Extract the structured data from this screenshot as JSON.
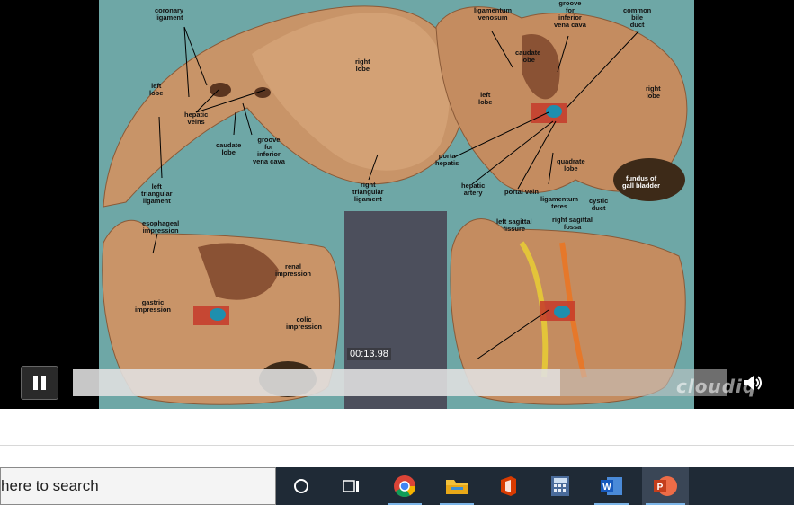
{
  "slide_labels": {
    "coronary_ligament": "coronary\nligament",
    "right_lobe_1": "right\nlobe",
    "left_lobe_1": "left\nlobe",
    "hepatic_veins": "hepatic\nveins",
    "caudate_lobe_1": "caudate\nlobe",
    "groove_ivc_1": "groove\nfor\ninferior\nvena cava",
    "left_triangular_ligament": "left\ntriangular\nligament",
    "right_triangular_ligament": "right\ntriangular\nligament",
    "ligamentum_venosum": "ligamentum\nvenosum",
    "groove_ivc_2": "groove\nfor\ninferior\nvena cava",
    "common_bile_duct": "common\nbile\nduct",
    "caudate_lobe_2": "caudate\nlobe",
    "left_lobe_2": "left\nlobe",
    "right_lobe_2": "right\nlobe",
    "porta_hepatis": "porta\nhepatis",
    "quadrate_lobe": "quadrate\nlobe",
    "hepatic_artery": "hepatic\nartery",
    "portal_vein": "portal vein",
    "ligamentum_teres": "ligamentum\nteres",
    "cystic_duct": "cystic\nduct",
    "fundus_gallbladder": "fundus of\ngall bladder",
    "esophageal_impression": "esophageal\nimpression",
    "renal_impression": "renal\nimpression",
    "gastric_impression": "gastric\nimpression",
    "colic_impression": "colic\nimpression",
    "left_sagittal_fissure": "left sagittal\nfissure",
    "right_sagittal_fossa": "right sagittal\nfossa"
  },
  "player": {
    "timestamp": "00:13.98",
    "progress_fraction": 0.745,
    "watermark": "cloudiq"
  },
  "taskbar": {
    "search_placeholder": "here to search",
    "apps": [
      "cortana-icon",
      "task-view-icon",
      "chrome-icon",
      "file-explorer-icon",
      "office-icon",
      "calculator-icon",
      "word-icon",
      "powerpoint-icon"
    ]
  },
  "colors": {
    "slide_bg": "#6ea7a6",
    "liver": "#b9825a",
    "taskbar": "#1f2a36"
  }
}
